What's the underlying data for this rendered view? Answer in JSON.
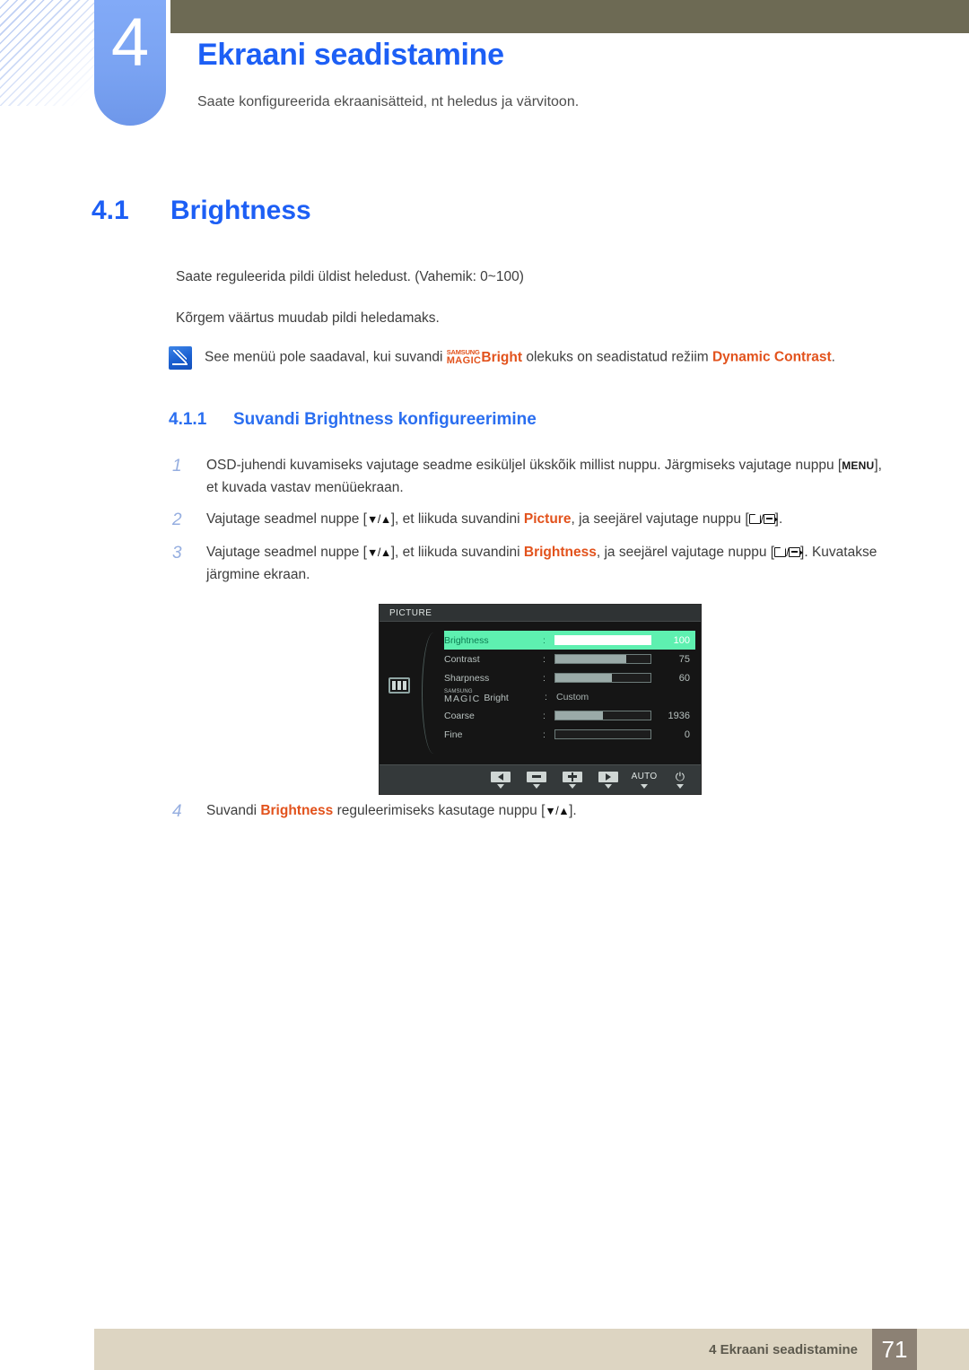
{
  "chapter": {
    "number": "4",
    "title": "Ekraani seadistamine",
    "subtitle": "Saate konfigureerida ekraanisätteid, nt heledus ja värvitoon."
  },
  "section": {
    "number": "4.1",
    "title": "Brightness",
    "paragraph1": "Saate reguleerida pildi üldist heledust. (Vahemik: 0~100)",
    "paragraph2": "Kõrgem väärtus muudab pildi heledamaks."
  },
  "note": {
    "icon": "note-pen-icon",
    "text_before": "See menüü pole saadaval, kui suvandi",
    "magic_samsung": "SAMSUNG",
    "magic_word": "MAGIC",
    "magic_bright": "Bright",
    "text_middle": "olekuks on seadistatud režiim",
    "accent_term": "Dynamic Contrast",
    "text_after": "."
  },
  "subsection": {
    "number": "4.1.1",
    "title": "Suvandi Brightness konfigureerimine"
  },
  "steps": [
    {
      "index": "1",
      "part1": "OSD-juhendi kuvamiseks vajutage seadme esiküljel ükskõik millist nuppu. Järgmiseks vajutage nuppu [",
      "key": "MENU",
      "part2": "], et kuvada vastav menüüekraan."
    },
    {
      "index": "2",
      "part1": "Vajutage seadmel nuppe [",
      "arrows": "▼/▲",
      "part2": "], et liikuda suvandini ",
      "accent": "Picture",
      "part3": ", ja seejärel vajutage nuppu [",
      "part4": "]."
    },
    {
      "index": "3",
      "part1": "Vajutage seadmel nuppe [",
      "arrows": "▼/▲",
      "part2": "], et liikuda suvandini ",
      "accent": "Brightness",
      "part3": ", ja seejärel vajutage nuppu [",
      "part4": "]. Kuvatakse järgmine ekraan."
    },
    {
      "index": "4",
      "part1": "Suvandi ",
      "accent": "Brightness",
      "part2": " reguleerimiseks kasutage nuppu [",
      "arrows": "▼/▲",
      "part3": "]."
    }
  ],
  "osd": {
    "title": "PICTURE",
    "left_icon": "picture-bars-icon",
    "colon": ":",
    "rows": [
      {
        "label": "Brightness",
        "value": "100",
        "type": "slider",
        "fill_percent": 100,
        "selected": true
      },
      {
        "label": "Contrast",
        "value": "75",
        "type": "slider",
        "fill_percent": 75,
        "selected": false
      },
      {
        "label": "Sharpness",
        "value": "60",
        "type": "slider",
        "fill_percent": 60,
        "selected": false
      },
      {
        "label_samsung": "SAMSUNG",
        "label_magic": "MAGIC",
        "label_bright": "Bright",
        "value": "Custom",
        "type": "text",
        "selected": false
      },
      {
        "label": "Coarse",
        "value": "1936",
        "type": "slider",
        "fill_percent": 50,
        "selected": false
      },
      {
        "label": "Fine",
        "value": "0",
        "type": "slider",
        "fill_percent": 0,
        "selected": false
      }
    ],
    "buttons": [
      {
        "name": "left-arrow-button",
        "glyph": "◀"
      },
      {
        "name": "minus-button",
        "glyph": "−"
      },
      {
        "name": "plus-button",
        "glyph": "+"
      },
      {
        "name": "right-arrow-button",
        "glyph": "▶"
      },
      {
        "name": "auto-button",
        "glyph": "AUTO"
      },
      {
        "name": "power-button",
        "glyph": "⏻"
      }
    ]
  },
  "footer": {
    "text": "4 Ekraani seadistamine",
    "page": "71"
  },
  "colors": {
    "brand_blue": "#1d5ff5",
    "header_brown": "#6d6a54",
    "accent_orange": "#e2521c",
    "osd_highlight": "#5ef0b0",
    "footer_tan": "#ddd5c2",
    "footer_page_box": "#8c8174"
  }
}
